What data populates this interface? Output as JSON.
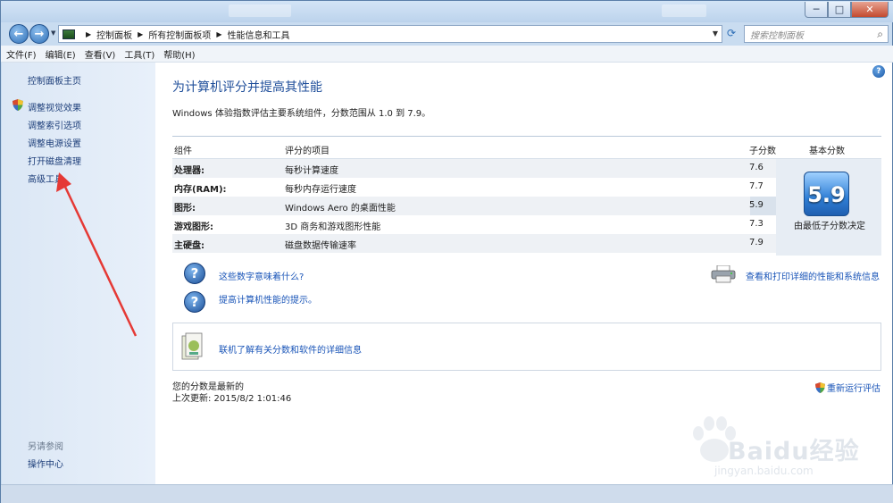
{
  "window": {
    "min_label": "─",
    "max_label": "□",
    "close_label": "✕"
  },
  "address": {
    "crumbs": [
      "控制面板",
      "所有控制面板项",
      "性能信息和工具"
    ],
    "search_placeholder": "搜索控制面板"
  },
  "menu": [
    "文件(F)",
    "编辑(E)",
    "查看(V)",
    "工具(T)",
    "帮助(H)"
  ],
  "sidebar": {
    "home": "控制面板主页",
    "links": [
      "调整视觉效果",
      "调整索引选项",
      "调整电源设置",
      "打开磁盘清理",
      "高级工具"
    ],
    "see_also_title": "另请参阅",
    "see_also": [
      "操作中心"
    ]
  },
  "main": {
    "title": "为计算机评分并提高其性能",
    "subtitle": "Windows 体验指数评估主要系统组件，分数范围从 1.0 到 7.9。",
    "headers": {
      "component": "组件",
      "rated": "评分的项目",
      "subscore": "子分数",
      "base": "基本分数"
    },
    "rows": [
      {
        "component": "处理器:",
        "item": "每秒计算速度",
        "score": "7.6"
      },
      {
        "component": "内存(RAM):",
        "item": "每秒内存运行速度",
        "score": "7.7"
      },
      {
        "component": "图形:",
        "item": "Windows Aero 的桌面性能",
        "score": "5.9"
      },
      {
        "component": "游戏图形:",
        "item": "3D 商务和游戏图形性能",
        "score": "7.3"
      },
      {
        "component": "主硬盘:",
        "item": "磁盘数据传输速率",
        "score": "7.9"
      }
    ],
    "base_score": "5.9",
    "base_caption": "由最低子分数决定",
    "link_meaning": "这些数字意味着什么?",
    "link_tips": "提高计算机性能的提示。",
    "link_print": "查看和打印详细的性能和系统信息",
    "link_online": "联机了解有关分数和软件的详细信息",
    "status_line1": "您的分数是最新的",
    "status_line2": "上次更新: 2015/8/2 1:01:46",
    "rerun": "重新运行评估"
  },
  "watermark": {
    "text": "Baidu经验",
    "url": "jingyan.baidu.com"
  },
  "colors": {
    "link": "#1a55b8",
    "title": "#1f4e9a",
    "arrow": "#e53935"
  }
}
